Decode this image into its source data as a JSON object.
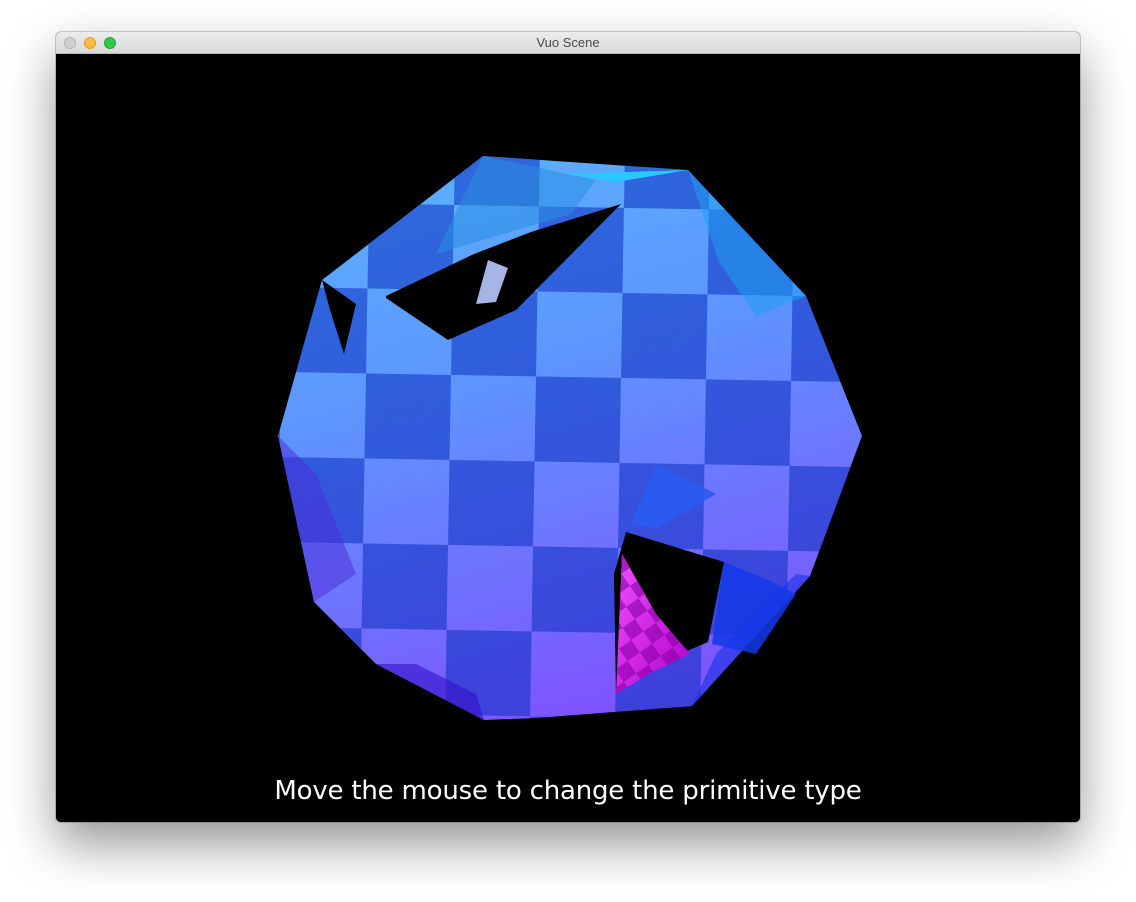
{
  "window": {
    "title": "Vuo Scene"
  },
  "scene": {
    "caption": "Move the mouse to change the primitive type",
    "object": "checkered-sphere-with-holes",
    "colors": {
      "light_blue": "#4fa0ff",
      "dark_blue": "#1540d0",
      "violet": "#6f50ff",
      "magenta": "#e040f0"
    }
  }
}
